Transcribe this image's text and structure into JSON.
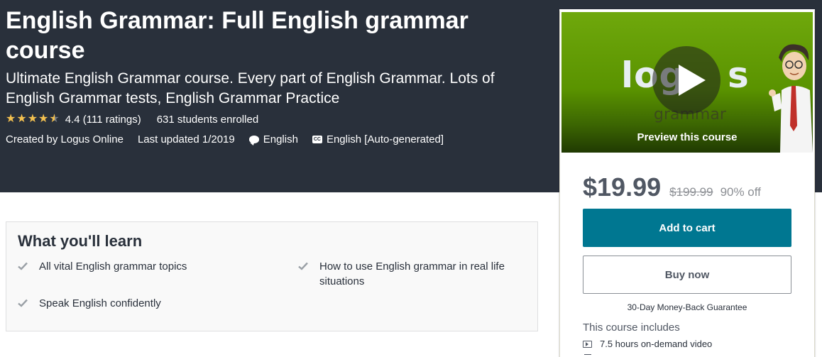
{
  "course": {
    "title": "English Grammar: Full English grammar course",
    "subtitle": "Ultimate English Grammar course. Every part of English Grammar. Lots of English Grammar tests, English Grammar Practice",
    "rating": 4.4,
    "rating_stars": 4.5,
    "rating_text": "4.4 (111 ratings)",
    "students": "631 students enrolled",
    "created_by": "Created by Logus Online",
    "last_updated": "Last updated 1/2019",
    "language": "English",
    "captions": "English [Auto-generated]"
  },
  "icons": {
    "star": "star-icon",
    "language": "speech-bubble-icon",
    "captions": "closed-captions-icon",
    "check": "check-icon",
    "play": "play-icon",
    "video": "video-icon"
  },
  "learn": {
    "title": "What you'll learn",
    "items": [
      "All vital English grammar topics",
      "How to use English grammar in real life situations",
      "Speak English confidently"
    ]
  },
  "sidebar": {
    "preview_logo_left": "log",
    "preview_logo_right": "s",
    "preview_logo_sub": "grammar",
    "preview_label": "Preview this course",
    "price": "$19.99",
    "original_price": "$199.99",
    "discount": "90% off",
    "add_to_cart": "Add to cart",
    "buy_now": "Buy now",
    "guarantee": "30-Day Money-Back Guarantee",
    "includes_title": "This course includes",
    "includes": [
      "7.5 hours on-demand video"
    ]
  },
  "colors": {
    "hero_bg": "#29303b",
    "star": "#f4c150",
    "cart_button": "#007791",
    "preview_green": "#5a9300"
  }
}
